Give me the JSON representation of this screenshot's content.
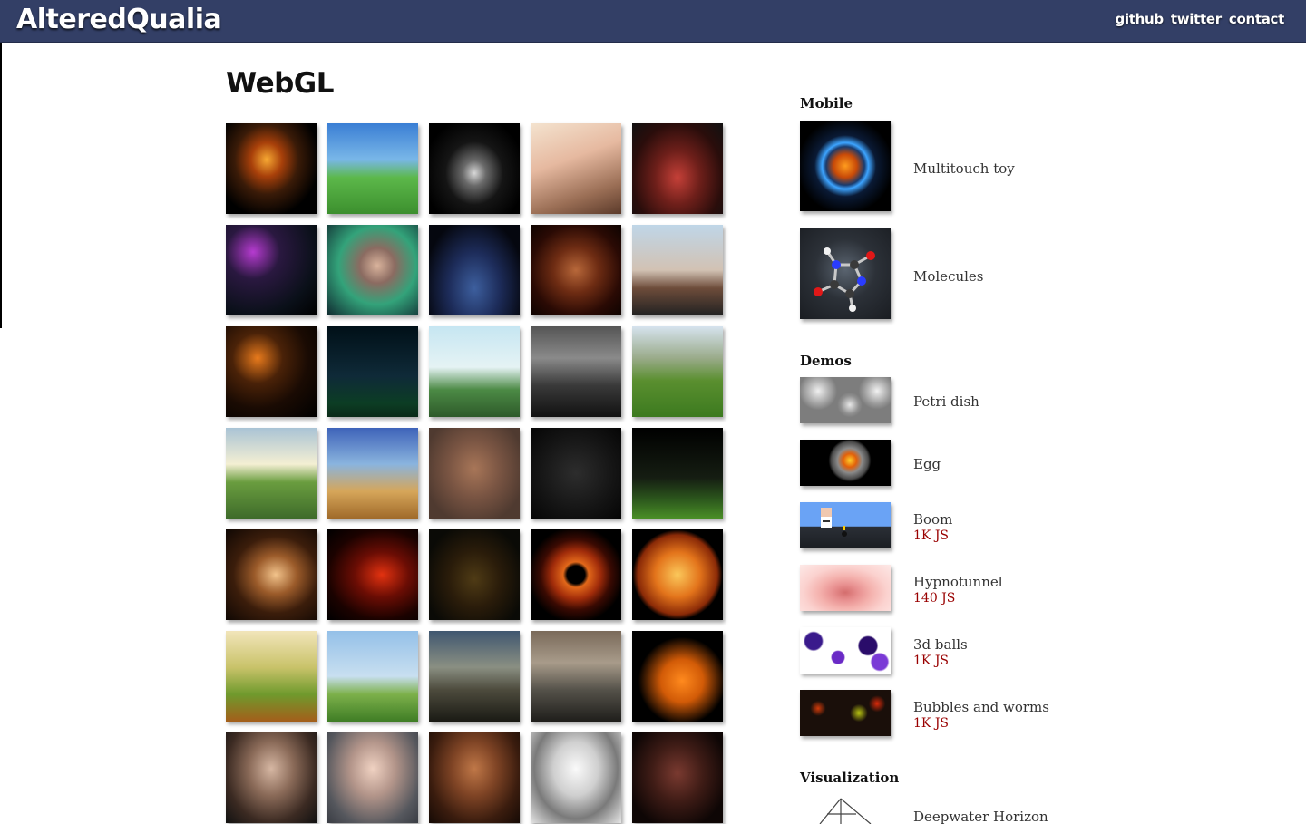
{
  "header": {
    "brand": "AlteredQualia",
    "nav": [
      "github",
      "twitter",
      "contact"
    ],
    "background_color": "#333f66"
  },
  "main": {
    "title": "WebGL",
    "thumbnail_count": 35
  },
  "sidebar": {
    "sections": [
      {
        "title": "Mobile",
        "items": [
          {
            "name": "Multitouch toy",
            "tag": ""
          },
          {
            "name": "Molecules",
            "tag": ""
          }
        ]
      },
      {
        "title": "Demos",
        "items": [
          {
            "name": "Petri dish",
            "tag": ""
          },
          {
            "name": "Egg",
            "tag": ""
          },
          {
            "name": "Boom",
            "tag": "1K JS"
          },
          {
            "name": "Hypnotunnel",
            "tag": "140 JS"
          },
          {
            "name": "3d balls",
            "tag": "1K JS"
          },
          {
            "name": "Bubbles and worms",
            "tag": "1K JS"
          }
        ]
      },
      {
        "title": "Visualization",
        "items": [
          {
            "name": "Deepwater Horizon",
            "tag": ""
          }
        ]
      }
    ]
  },
  "colors": {
    "tag_text": "#990000",
    "link_text": "#333333"
  }
}
